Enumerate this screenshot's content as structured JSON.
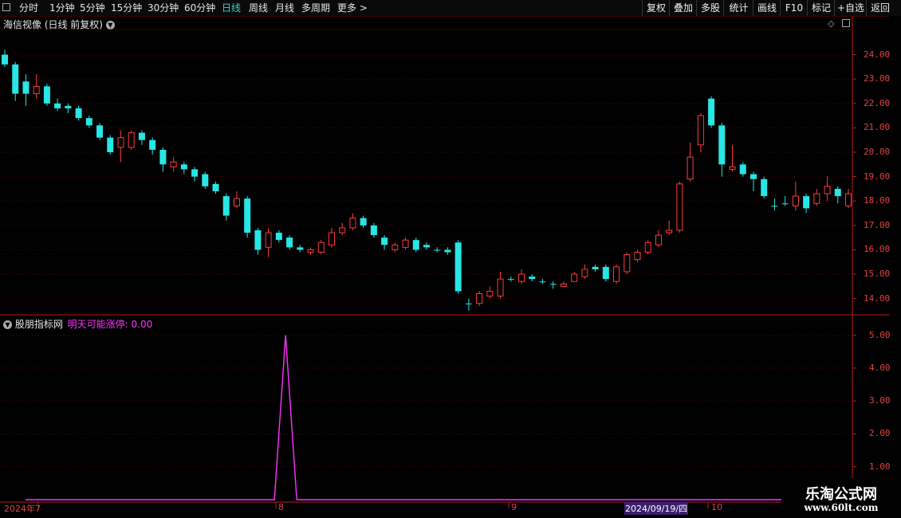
{
  "toolbar": {
    "periods": [
      "分时",
      "1分钟",
      "5分钟",
      "15分钟",
      "30分钟",
      "60分钟",
      "日线",
      "周线",
      "月线",
      "多周期",
      "更多 >"
    ],
    "active_period": "日线",
    "buttons": [
      "复权",
      "叠加",
      "多股",
      "统计",
      "画线",
      "F10",
      "标记",
      "+自选",
      "返回"
    ]
  },
  "main_pane": {
    "title": "海信视像 (日线 前复权)",
    "y_labels": [
      "24.00",
      "23.00",
      "22.00",
      "21.00",
      "20.00",
      "19.00",
      "18.00",
      "17.00",
      "16.00",
      "15.00",
      "14.00"
    ]
  },
  "indicator_pane": {
    "name": "股朋指标网",
    "series_label": "明天可能涨停: 0.00",
    "y_labels": [
      "5.00",
      "4.00",
      "3.00",
      "2.00",
      "1.00"
    ]
  },
  "date_axis": {
    "labels": [
      "2024年7",
      "8",
      "9",
      "2024/09/19/四",
      "10"
    ]
  },
  "watermark": {
    "line1": "乐淘公式网",
    "line2": "www.60lt.com"
  },
  "colors": {
    "up": "#ff3b3b",
    "down": "#26e6e6",
    "indicator": "#ff33ff",
    "axis": "#b81c1c",
    "active": "#36d3d6"
  },
  "chart_data": [
    {
      "type": "candlestick",
      "ylim": [
        13.4,
        25.0
      ],
      "candles": [
        [
          24.0,
          23.6,
          24.2,
          23.5
        ],
        [
          23.6,
          22.4,
          23.7,
          22.1
        ],
        [
          22.9,
          22.4,
          23.2,
          21.9
        ],
        [
          22.4,
          22.7,
          23.2,
          22.2
        ],
        [
          22.7,
          22.0,
          22.8,
          21.9
        ],
        [
          22.0,
          21.8,
          22.2,
          21.7
        ],
        [
          21.9,
          21.8,
          22.0,
          21.6
        ],
        [
          21.8,
          21.4,
          21.9,
          21.3
        ],
        [
          21.4,
          21.1,
          21.5,
          21.0
        ],
        [
          21.1,
          20.6,
          21.2,
          20.5
        ],
        [
          20.6,
          20.0,
          20.7,
          19.9
        ],
        [
          20.2,
          20.6,
          20.9,
          19.6
        ],
        [
          20.2,
          20.8,
          20.9,
          20.1
        ],
        [
          20.8,
          20.5,
          20.9,
          20.3
        ],
        [
          20.5,
          20.1,
          20.6,
          19.9
        ],
        [
          20.1,
          19.5,
          20.2,
          19.2
        ],
        [
          19.4,
          19.6,
          19.8,
          19.2
        ],
        [
          19.5,
          19.3,
          19.6,
          19.1
        ],
        [
          19.3,
          19.0,
          19.4,
          18.8
        ],
        [
          19.1,
          18.6,
          19.2,
          18.5
        ],
        [
          18.7,
          18.4,
          18.8,
          18.3
        ],
        [
          18.2,
          17.4,
          18.3,
          17.2
        ],
        [
          17.8,
          18.1,
          18.4,
          17.7
        ],
        [
          18.1,
          16.7,
          18.2,
          16.5
        ],
        [
          16.8,
          16.0,
          16.9,
          15.8
        ],
        [
          16.1,
          16.7,
          16.9,
          15.7
        ],
        [
          16.7,
          16.4,
          16.8,
          16.3
        ],
        [
          16.5,
          16.1,
          16.6,
          16.0
        ],
        [
          16.1,
          16.0,
          16.2,
          15.9
        ],
        [
          15.9,
          16.0,
          16.1,
          15.8
        ],
        [
          15.9,
          16.3,
          16.4,
          15.8
        ],
        [
          16.2,
          16.7,
          16.9,
          16.1
        ],
        [
          16.7,
          16.9,
          17.1,
          16.6
        ],
        [
          16.9,
          17.3,
          17.5,
          16.8
        ],
        [
          17.3,
          17.0,
          17.4,
          16.9
        ],
        [
          17.0,
          16.6,
          17.1,
          16.5
        ],
        [
          16.5,
          16.2,
          16.6,
          16.0
        ],
        [
          16.0,
          16.2,
          16.3,
          15.9
        ],
        [
          16.1,
          16.4,
          16.5,
          16.0
        ],
        [
          16.4,
          16.0,
          16.5,
          15.9
        ],
        [
          16.2,
          16.1,
          16.3,
          16.0
        ],
        [
          16.0,
          16.0,
          16.1,
          15.9
        ],
        [
          16.0,
          15.9,
          16.1,
          15.8
        ],
        [
          16.3,
          14.3,
          16.4,
          14.2
        ],
        [
          13.8,
          13.8,
          14.0,
          13.5
        ],
        [
          13.8,
          14.2,
          14.3,
          13.7
        ],
        [
          14.1,
          14.3,
          14.5,
          14.0
        ],
        [
          14.1,
          14.8,
          15.1,
          14.0
        ],
        [
          14.8,
          14.8,
          14.9,
          14.7
        ],
        [
          14.7,
          15.0,
          15.2,
          14.6
        ],
        [
          14.9,
          14.8,
          15.0,
          14.7
        ],
        [
          14.7,
          14.7,
          14.8,
          14.6
        ],
        [
          14.6,
          14.6,
          14.7,
          14.4
        ],
        [
          14.5,
          14.6,
          14.7,
          14.5
        ],
        [
          14.7,
          15.0,
          15.1,
          14.7
        ],
        [
          14.9,
          15.2,
          15.4,
          14.8
        ],
        [
          15.3,
          15.2,
          15.4,
          15.1
        ],
        [
          15.3,
          14.8,
          15.4,
          14.7
        ],
        [
          14.7,
          15.3,
          15.4,
          14.6
        ],
        [
          15.1,
          15.8,
          15.9,
          15.0
        ],
        [
          15.6,
          15.9,
          16.0,
          15.5
        ],
        [
          15.9,
          16.3,
          16.4,
          15.8
        ],
        [
          16.2,
          16.6,
          16.8,
          16.1
        ],
        [
          16.7,
          16.8,
          17.2,
          16.6
        ],
        [
          16.8,
          18.7,
          18.8,
          16.7
        ],
        [
          18.9,
          19.8,
          20.4,
          18.8
        ],
        [
          20.3,
          21.5,
          21.6,
          20.0
        ],
        [
          22.2,
          21.1,
          22.3,
          21.0
        ],
        [
          21.1,
          19.5,
          21.2,
          19.0
        ],
        [
          19.3,
          19.4,
          20.3,
          19.2
        ],
        [
          19.5,
          19.1,
          19.6,
          19.0
        ],
        [
          19.1,
          18.9,
          19.2,
          18.4
        ],
        [
          18.9,
          18.2,
          19.0,
          18.1
        ],
        [
          17.8,
          17.8,
          18.1,
          17.6
        ],
        [
          17.9,
          17.9,
          18.2,
          17.8
        ],
        [
          17.8,
          18.2,
          18.8,
          17.6
        ],
        [
          18.2,
          17.7,
          18.3,
          17.5
        ],
        [
          17.9,
          18.3,
          18.5,
          17.8
        ],
        [
          18.3,
          18.6,
          19.0,
          18.0
        ],
        [
          18.5,
          18.2,
          18.6,
          17.9
        ],
        [
          17.8,
          18.3,
          18.5,
          17.7
        ]
      ]
    },
    {
      "type": "line",
      "series": [
        {
          "name": "明天可能涨停",
          "peak_value": 5.0,
          "peak_index": 23
        }
      ],
      "ylim": [
        0,
        5.5
      ]
    }
  ]
}
